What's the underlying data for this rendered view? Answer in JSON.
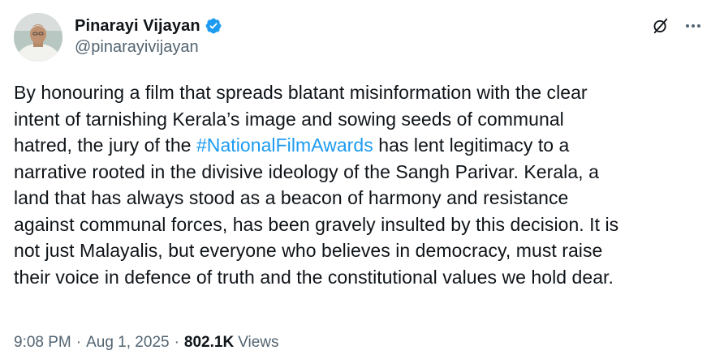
{
  "author": {
    "display_name": "Pinarayi Vijayan",
    "handle": "@pinarayivijayan",
    "verified": true
  },
  "icons": {
    "verified": "verified-badge-icon",
    "grok": "grok-icon",
    "more": "more-options-icon"
  },
  "colors": {
    "link": "#1d9bf0",
    "text": "#0f1419",
    "secondary": "#536471",
    "verified": "#1d9bf0"
  },
  "tweet": {
    "lines": [
      {
        "before": "By honouring a film that spreads blatant misinformation with the clear"
      },
      {
        "before": "intent of tarnishing Kerala’s image and sowing seeds of communal"
      },
      {
        "before": "hatred, the jury of the ",
        "hashtag": "#NationalFilmAwards",
        "after": " has lent legitimacy to a"
      },
      {
        "before": "narrative rooted in the divisive ideology of the Sangh Parivar. Kerala, a"
      },
      {
        "before": "land that has always stood as a beacon of harmony and resistance"
      },
      {
        "before": "against communal forces, has been gravely insulted by this decision. It is"
      },
      {
        "before": "not just Malayalis, but everyone who believes in democracy, must raise"
      },
      {
        "before": "their voice in defence of truth and the constitutional values we hold dear."
      }
    ]
  },
  "meta": {
    "time": "9:08 PM",
    "date": "Aug 1, 2025",
    "separator": "·",
    "views_count": "802.1K",
    "views_label": "Views"
  }
}
